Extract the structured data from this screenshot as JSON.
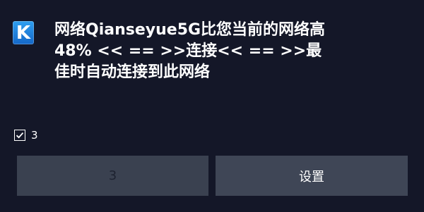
{
  "app": {
    "icon_letter": "K",
    "icon_name": "app-k-icon"
  },
  "message": {
    "lines": [
      "网络Qianseyue5G比您当前的网络高",
      "48% << == >>连接<< == >>最",
      "佳时自动连接到此网络"
    ]
  },
  "checkbox": {
    "checked": true,
    "label": "3"
  },
  "buttons": {
    "disabled_label": "3",
    "settings_label": "设置"
  },
  "colors": {
    "background": "#141728",
    "icon_blue": "#1f8ae0",
    "button_bg": "#3f4656",
    "disabled_text": "#1d2230"
  }
}
